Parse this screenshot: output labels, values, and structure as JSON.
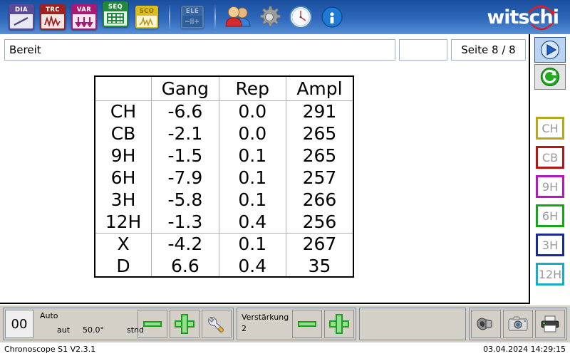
{
  "toolbar": {
    "buttons": [
      {
        "name": "dia",
        "label": "DIA",
        "icon": "diagram-icon"
      },
      {
        "name": "trc",
        "label": "TRC",
        "icon": "trace-icon"
      },
      {
        "name": "var",
        "label": "VAR",
        "icon": "variation-icon"
      },
      {
        "name": "seq",
        "label": "SEQ",
        "icon": "sequence-icon"
      },
      {
        "name": "sco",
        "label": "SCO",
        "icon": "scope-icon"
      },
      {
        "name": "ele",
        "label": "ELE",
        "icon": "electronic-icon"
      }
    ],
    "users_icon": "users-icon",
    "settings_icon": "gear-icon",
    "clock_icon": "clock-icon",
    "info_icon": "info-icon",
    "brand": "witschi"
  },
  "status": {
    "message": "Bereit",
    "message_placeholder": "Bereit",
    "secondary": "",
    "page": "Seite 8 / 8"
  },
  "sidebar": {
    "play_icon": "play-icon",
    "refresh_icon": "refresh-icon",
    "positions": [
      {
        "label": "CH",
        "color": "#b5a81c"
      },
      {
        "label": "CB",
        "color": "#b81414"
      },
      {
        "label": "9H",
        "color": "#b417c4"
      },
      {
        "label": "6H",
        "color": "#16a616"
      },
      {
        "label": "3H",
        "color": "#172a9e"
      },
      {
        "label": "12H",
        "color": "#16aec4"
      }
    ]
  },
  "table": {
    "headers": [
      "",
      "Gang",
      "Rep",
      "Ampl"
    ],
    "rows": [
      {
        "label": "CH",
        "gang": "-6.6",
        "rep": "0.0",
        "ampl": "291",
        "sep": false
      },
      {
        "label": "CB",
        "gang": "-2.1",
        "rep": "0.0",
        "ampl": "265",
        "sep": false
      },
      {
        "label": "9H",
        "gang": "-1.5",
        "rep": "0.1",
        "ampl": "265",
        "sep": false
      },
      {
        "label": "6H",
        "gang": "-7.9",
        "rep": "0.1",
        "ampl": "257",
        "sep": false
      },
      {
        "label": "3H",
        "gang": "-5.8",
        "rep": "0.1",
        "ampl": "266",
        "sep": false
      },
      {
        "label": "12H",
        "gang": "-1.3",
        "rep": "0.4",
        "ampl": "256",
        "sep": false
      },
      {
        "label": "X",
        "gang": "-4.2",
        "rep": "0.1",
        "ampl": "267",
        "sep": true
      },
      {
        "label": "D",
        "gang": "6.6",
        "rep": "0.4",
        "ampl": "35",
        "sep": false
      }
    ]
  },
  "bottom": {
    "counter": "00",
    "mode_title": "Auto",
    "mode_aut": "aut",
    "angle": "50.0°",
    "mode_stnd": "stnd",
    "minus_icon": "minus-icon",
    "plus_icon": "plus-icon",
    "wrench_icon": "wrench-icon",
    "gain_label": "Verstärkung",
    "gain_value": "2",
    "speaker_icon": "speaker-icon",
    "camera_icon": "camera-icon",
    "printer_icon": "printer-icon"
  },
  "footer": {
    "app": "Chronoscope S1 V2.3.1",
    "datetime": "03.04.2024 14:29:15"
  }
}
